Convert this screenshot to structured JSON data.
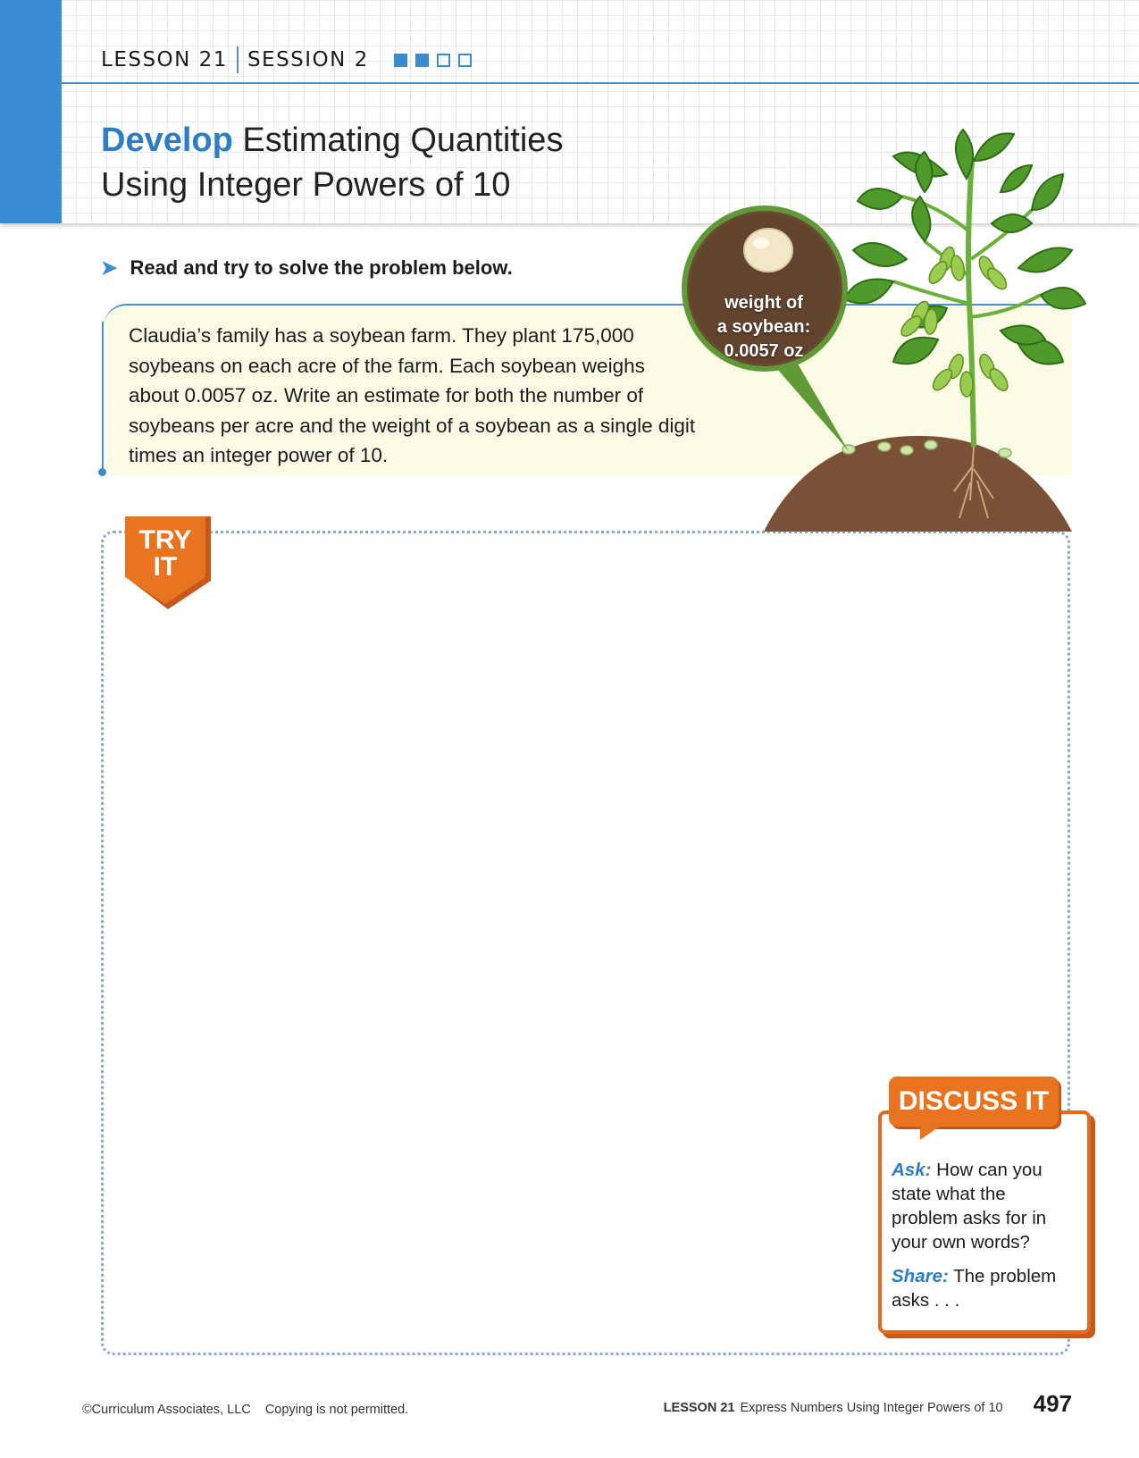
{
  "header": {
    "lesson": "LESSON 21",
    "session": "SESSION 2",
    "progress": [
      true,
      true,
      false,
      false
    ],
    "title_highlight": "Develop",
    "title_line1": "Estimating Quantities",
    "title_line2": "Using Integer Powers of 10"
  },
  "instruction": "Read and try to solve the problem below.",
  "problem": {
    "lines": [
      "Claudia’s family has a soybean farm. They plant 175,000",
      "soybeans on each acre of the farm. Each soybean weighs",
      "about 0.0057 oz. Write an estimate for both the number of",
      "soybeans per acre and the weight of a soybean as a single digit",
      "times an integer power of 10."
    ]
  },
  "illustration": {
    "bubble_line1": "weight of",
    "bubble_line2": "a soybean:",
    "bubble_line3": "0.0057 oz"
  },
  "try_it": {
    "line1": "TRY",
    "line2": "IT"
  },
  "discuss": {
    "title": "DISCUSS IT",
    "ask_label": "Ask:",
    "ask_text": " How can you state what the problem asks for in your own words?",
    "share_label": "Share:",
    "share_text": " The problem asks . . ."
  },
  "footer": {
    "copyright": "©Curriculum Associates, LLC",
    "notice": "Copying is not permitted.",
    "lesson_label": "LESSON 21",
    "lesson_title": "Express Numbers Using Integer Powers of 10",
    "page_number": "497"
  },
  "colors": {
    "accent_blue": "#3a8bd0",
    "orange": "#e8741f",
    "problem_bg": "#fbfbe6",
    "soil": "#7a5136",
    "leaf": "#4f9a2b"
  }
}
